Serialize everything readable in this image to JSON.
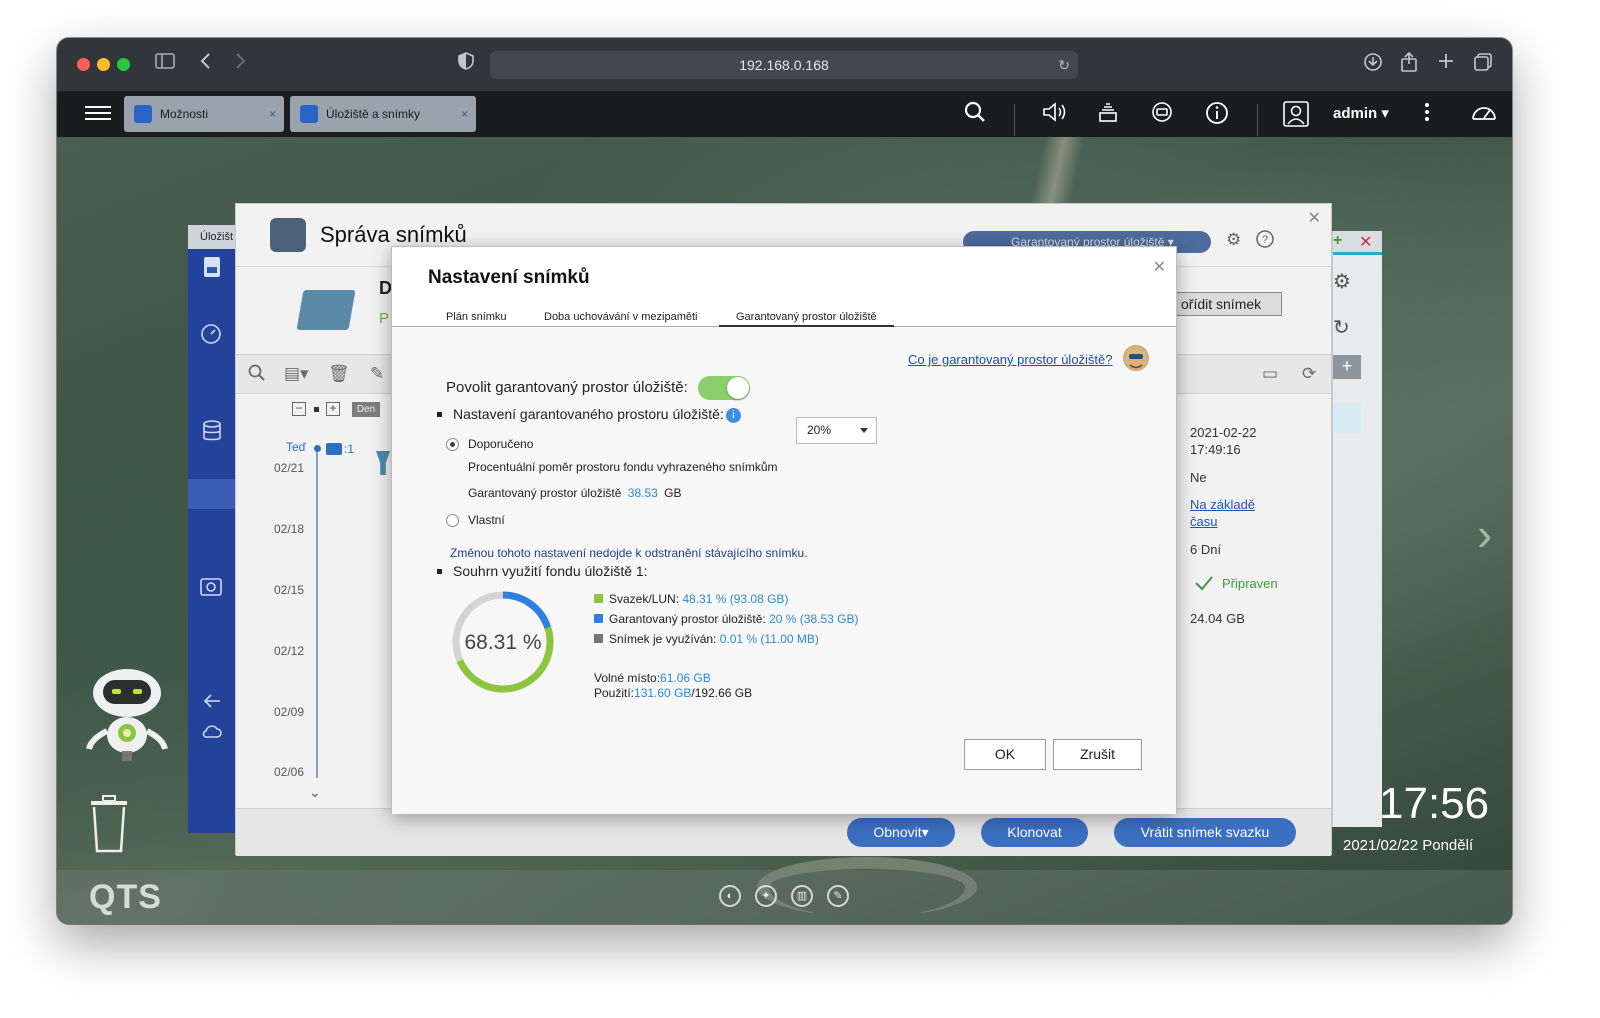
{
  "browser": {
    "url": "192.168.0.168"
  },
  "topbar": {
    "tabs": [
      {
        "label": "Možnosti"
      },
      {
        "label": "Úložiště a snímky"
      }
    ],
    "close_glyph": "×",
    "user": "admin ▾"
  },
  "manager": {
    "title": "Správa snímků",
    "sidebar_tab": "Úložišt",
    "header_letter": "D",
    "header_letter2": "P",
    "dropdown": "Garantovaný prostor úložiště ▾",
    "create_snapshot": "ořídit snímek",
    "timeline": {
      "zoom_label": "Den",
      "now_label": "Teď",
      "count": ":1",
      "dates": [
        "02/21",
        "02/18",
        "02/15",
        "02/12",
        "02/09",
        "02/06"
      ]
    },
    "details": {
      "created_date": "2021-02-22",
      "created_time": "17:49:16",
      "locked": "Ne",
      "type_line1": "Na základě",
      "type_line2": "času",
      "retention": "6 Dní",
      "status": "Připraven",
      "size": "24.04 GB"
    },
    "footer_buttons": [
      {
        "label": "Obnovit▾"
      },
      {
        "label": "Klonovat"
      },
      {
        "label": "Vrátit snímek svazku"
      }
    ]
  },
  "desktop": {
    "time": "17:56",
    "date": "2021/02/22 Pondělí",
    "logo": "QTS"
  },
  "dialog": {
    "title": "Nastavení snímků",
    "tabs": [
      {
        "label": "Plán snímku"
      },
      {
        "label": "Doba uchovávání v mezipaměti"
      },
      {
        "label": "Garantovaný prostor úložiště"
      }
    ],
    "help_link": "Co je garantovaný prostor úložiště?",
    "enable_label": "Povolit garantovaný prostor úložiště:",
    "enable_on": true,
    "settings_heading": "Nastavení garantovaného prostoru úložiště:",
    "recommended_label": "Doporučeno",
    "percent_label": "Procentuální poměr prostoru fondu vyhrazeného snímkům",
    "percent_value": "20%",
    "guaranteed_label": "Garantovaný prostor úložiště",
    "guaranteed_value": "38.53",
    "guaranteed_unit": "GB",
    "custom_label": "Vlastní",
    "warning": "Změnou tohoto nastavení nedojde k odstranění stávajícího snímku.",
    "summary_heading": "Souhrn využití fondu úložiště 1:",
    "donut_label": "68.31 %",
    "usage": {
      "volume_pct": 48.31,
      "reserved_pct": 20,
      "snapshot_pct": 0.01
    },
    "legend": [
      {
        "name": "Svazek/LUN:",
        "value": "48.31 % (93.08 GB)",
        "color": "#8cc63f"
      },
      {
        "name": "Garantovaný prostor úložiště:",
        "value": "20 % (38.53 GB)",
        "color": "#2f7fe0"
      },
      {
        "name": "Snímek je využíván:",
        "value": "0.01 % (11.00 MB)",
        "color": "#6f7a70"
      }
    ],
    "free_label": "Volné místo:",
    "free_value": "61.06 GB",
    "used_label": "Použití:",
    "used_value": "131.60 GB",
    "total_value": "/192.66 GB",
    "ok": "OK",
    "cancel": "Zrušit"
  }
}
